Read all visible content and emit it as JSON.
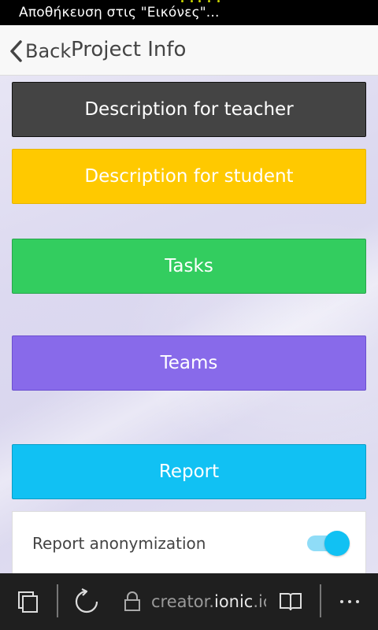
{
  "status_bar": {
    "text": "Αποθήκευση στις \"Εικόνες\"..."
  },
  "header": {
    "back_label": "Back",
    "title": "Project Info"
  },
  "buttons": {
    "teacher": "Description for teacher",
    "student": "Description for student",
    "tasks": "Tasks",
    "teams": "Teams",
    "report": "Report"
  },
  "toggle_item": {
    "label": "Report anonymization",
    "checked": true
  },
  "browser_bar": {
    "url_prefix": "creator.",
    "url_host": "ionic",
    "url_suffix": ".ic",
    "icons": [
      "tabs-icon",
      "refresh-icon",
      "lock-icon",
      "reading-view-icon",
      "more-icon"
    ]
  },
  "colors": {
    "dark": "#444444",
    "energized": "#ffc900",
    "balanced": "#33cd5f",
    "royal": "#886aea",
    "calm": "#11c1f3"
  }
}
